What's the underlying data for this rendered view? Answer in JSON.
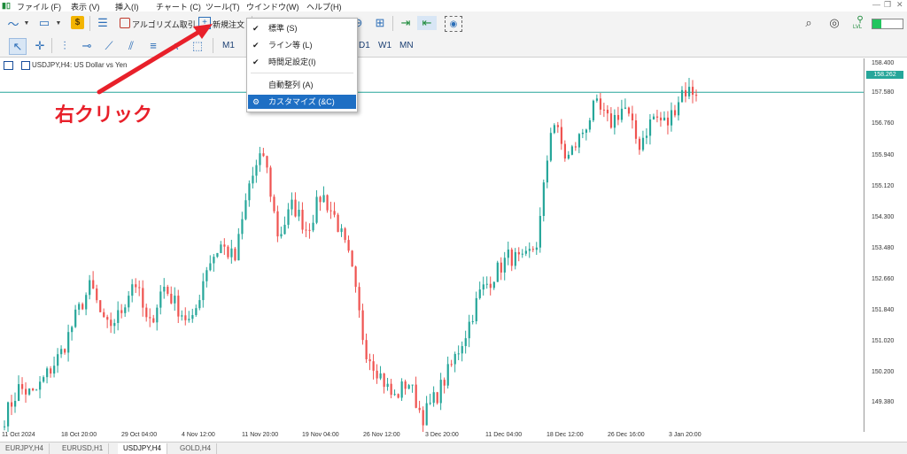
{
  "menu": {
    "items": [
      "ファイル (F)",
      "表示 (V)",
      "挿入(I)",
      "チャート (C)",
      "ツール(T)",
      "ウインドウ(W)",
      "ヘルプ(H)"
    ]
  },
  "toolbar": {
    "algo_label": "アルゴリズム取引",
    "new_order_label": "新規注文",
    "level_label": "LVL"
  },
  "timeframes": [
    "M1",
    "D1",
    "W1",
    "MN"
  ],
  "context_menu": {
    "items": [
      {
        "label": "標準 (S)",
        "checked": true
      },
      {
        "label": "ライン等 (L)",
        "checked": true
      },
      {
        "label": "時間足設定(I)",
        "checked": true
      },
      {
        "label": "自動整列 (A)",
        "checked": false
      },
      {
        "label": "カスタマイズ (&C)",
        "checked": false,
        "highlighted": true
      }
    ]
  },
  "annotation": {
    "text": "右クリック",
    "color": "#e8202a"
  },
  "chart": {
    "header": "USDJPY,H4:  US Dollar vs Yen",
    "current_price": "158.262",
    "y_labels": [
      "158.400",
      "157.580",
      "156.760",
      "155.940",
      "155.120",
      "154.300",
      "153.480",
      "152.660",
      "151.840",
      "151.020",
      "150.200",
      "149.380"
    ],
    "x_labels": [
      "11 Oct 2024",
      "18 Oct 20:00",
      "29 Oct 04:00",
      "4 Nov 12:00",
      "11 Nov 20:00",
      "19 Nov 04:00",
      "26 Nov 12:00",
      "3 Dec 20:00",
      "11 Dec 04:00",
      "18 Dec 12:00",
      "26 Dec 16:00",
      "3 Jan 20:00"
    ],
    "bull_color": "#26a69a",
    "bear_color": "#ef5350"
  },
  "chart_data": {
    "type": "line",
    "series": [
      {
        "values": [
          149.4,
          150.2,
          150.0,
          150.6,
          151.2,
          152.2,
          153.0,
          151.8,
          152.2,
          153.2,
          151.8,
          153.0,
          152.4,
          151.9,
          153.5,
          154.1,
          153.7,
          155.8,
          156.6,
          154.3,
          155.2,
          154.5,
          155.5,
          154.8,
          153.6,
          151.3,
          150.6,
          149.9,
          150.4,
          149.4,
          150.0,
          150.8,
          151.7,
          152.8,
          153.3,
          153.8,
          153.6,
          154.2,
          157.6,
          156.4,
          157.1,
          157.9,
          157.4,
          157.9,
          156.8,
          157.6,
          157.4,
          158.3,
          158.3
        ]
      }
    ],
    "ylim": [
      149.0,
      158.8
    ]
  },
  "tabs": [
    "EURJPY,H4",
    "EURUSD,H1",
    "USDJPY,H4",
    "GOLD,H4"
  ],
  "active_tab": "USDJPY,H4"
}
